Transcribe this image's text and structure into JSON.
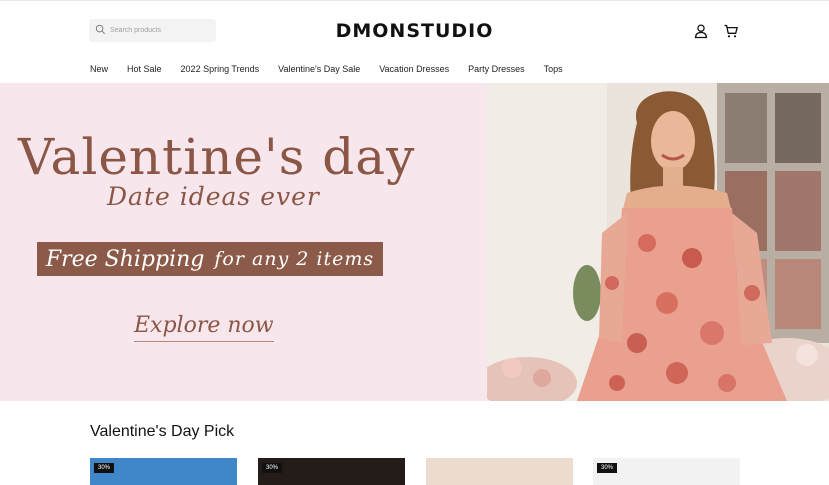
{
  "header": {
    "search_placeholder": "Search products",
    "logo": "DMONSTUDIO",
    "account_icon": "user-icon",
    "cart_icon": "cart-icon"
  },
  "nav": {
    "items": [
      {
        "label": "New"
      },
      {
        "label": "Hot Sale"
      },
      {
        "label": "2022 Spring Trends"
      },
      {
        "label": "Valentine's Day Sale"
      },
      {
        "label": "Vacation Dresses"
      },
      {
        "label": "Party Dresses"
      },
      {
        "label": "Tops"
      }
    ]
  },
  "banner": {
    "title": "Valentine's day",
    "subtitle": "Date ideas ever",
    "shipping_bold": "Free Shipping",
    "shipping_rest": "for any 2 items",
    "cta": "Explore now",
    "colors": {
      "background": "#f7e6ec",
      "text": "#8a5646",
      "ribbon": "#8c5a49"
    }
  },
  "section": {
    "title": "Valentine's Day Pick",
    "products": [
      {
        "badge": "30%",
        "color": "#3f87c9"
      },
      {
        "badge": "30%",
        "color": "#231c18"
      },
      {
        "badge": "",
        "color": "#ecdcd0"
      },
      {
        "badge": "30%",
        "color": "#f2f2f2"
      }
    ]
  }
}
